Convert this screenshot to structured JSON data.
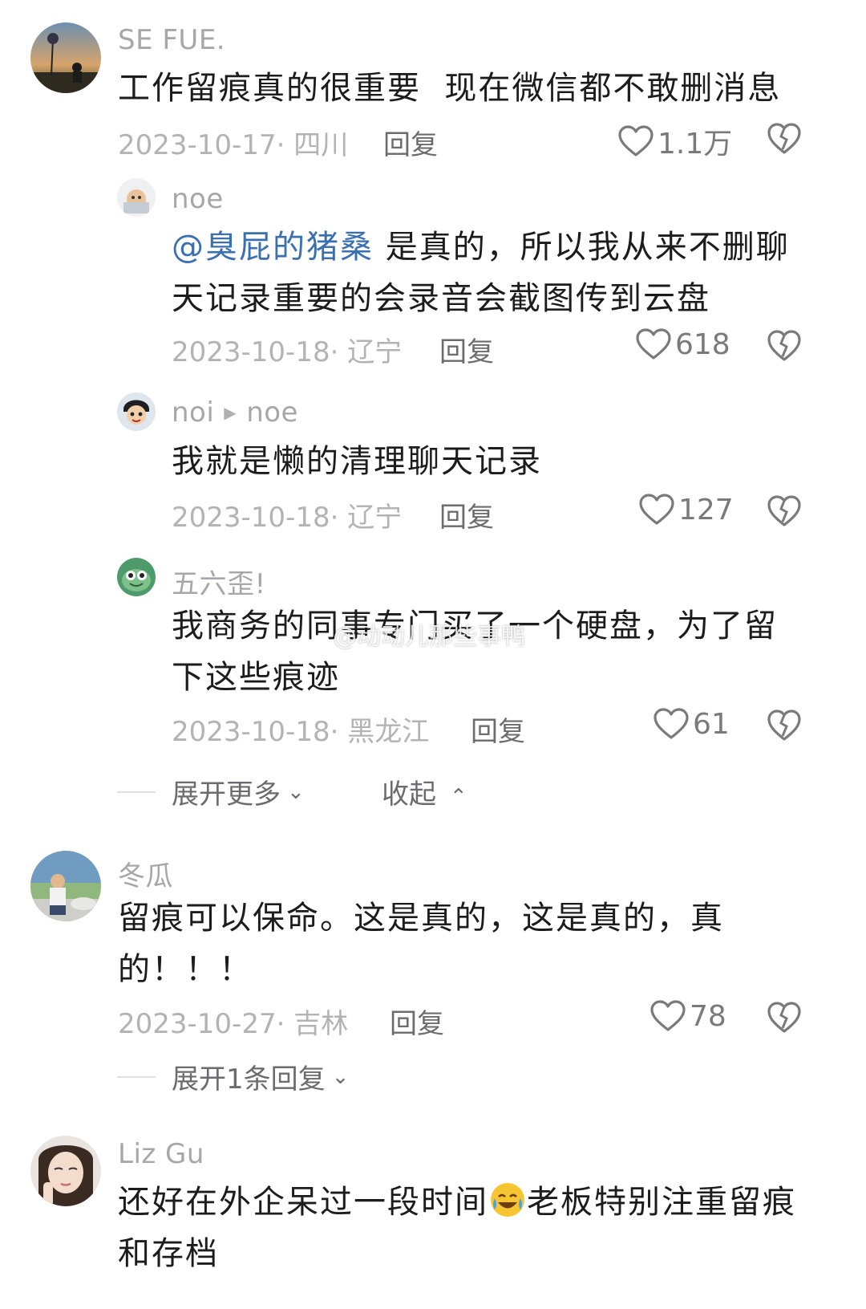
{
  "comments": [
    {
      "username": "SE FUE.",
      "text": "工作留痕真的很重要  现在微信都不敢删消息",
      "meta": "2023-10-17· 四川",
      "reply_label": "回复",
      "likes": "1.1万"
    },
    {
      "username": "noe",
      "mention": "@臭屁的猪桑",
      "text_line1": " 是真的，所以我从来不删聊",
      "text_line2": "天记录重要的会录音会截图传到云盘",
      "meta": "2023-10-18· 辽宁",
      "reply_label": "回复",
      "likes": "618"
    },
    {
      "username": "noi",
      "reply_to": "noe",
      "text": "我就是懒的清理聊天记录",
      "meta": "2023-10-18· 辽宁",
      "reply_label": "回复",
      "likes": "127"
    },
    {
      "username": "五六歪!",
      "text_line1": "我商务的同事专门买了一个硬盘，为了留",
      "text_line2": "下这些痕迹",
      "meta": "2023-10-18· 黑龙江",
      "reply_label": "回复",
      "likes": "61"
    },
    {
      "username": "冬瓜",
      "text_line1": "留痕可以保命。这是真的，这是真的，真",
      "text_line2": "的！！！",
      "meta": "2023-10-27· 吉林",
      "reply_label": "回复",
      "likes": "78"
    },
    {
      "username": "Liz Gu",
      "text_part1": "还好在外企呆过一段时间",
      "text_part2": "老板特别注重留痕",
      "text_line2": "和存档"
    }
  ],
  "thread_controls": {
    "expand_more": "展开更多",
    "collapse": "收起",
    "expand_one": "展开1条回复"
  },
  "watermark": "@动动儿那些事鸭",
  "icons": {
    "like": "heart-outline-icon",
    "dislike": "broken-heart-icon",
    "arrow": "triangle-right-icon",
    "chevron_down": "chevron-down-icon",
    "chevron_up": "chevron-up-icon",
    "emoji": "crying-laugh-emoji-icon"
  }
}
